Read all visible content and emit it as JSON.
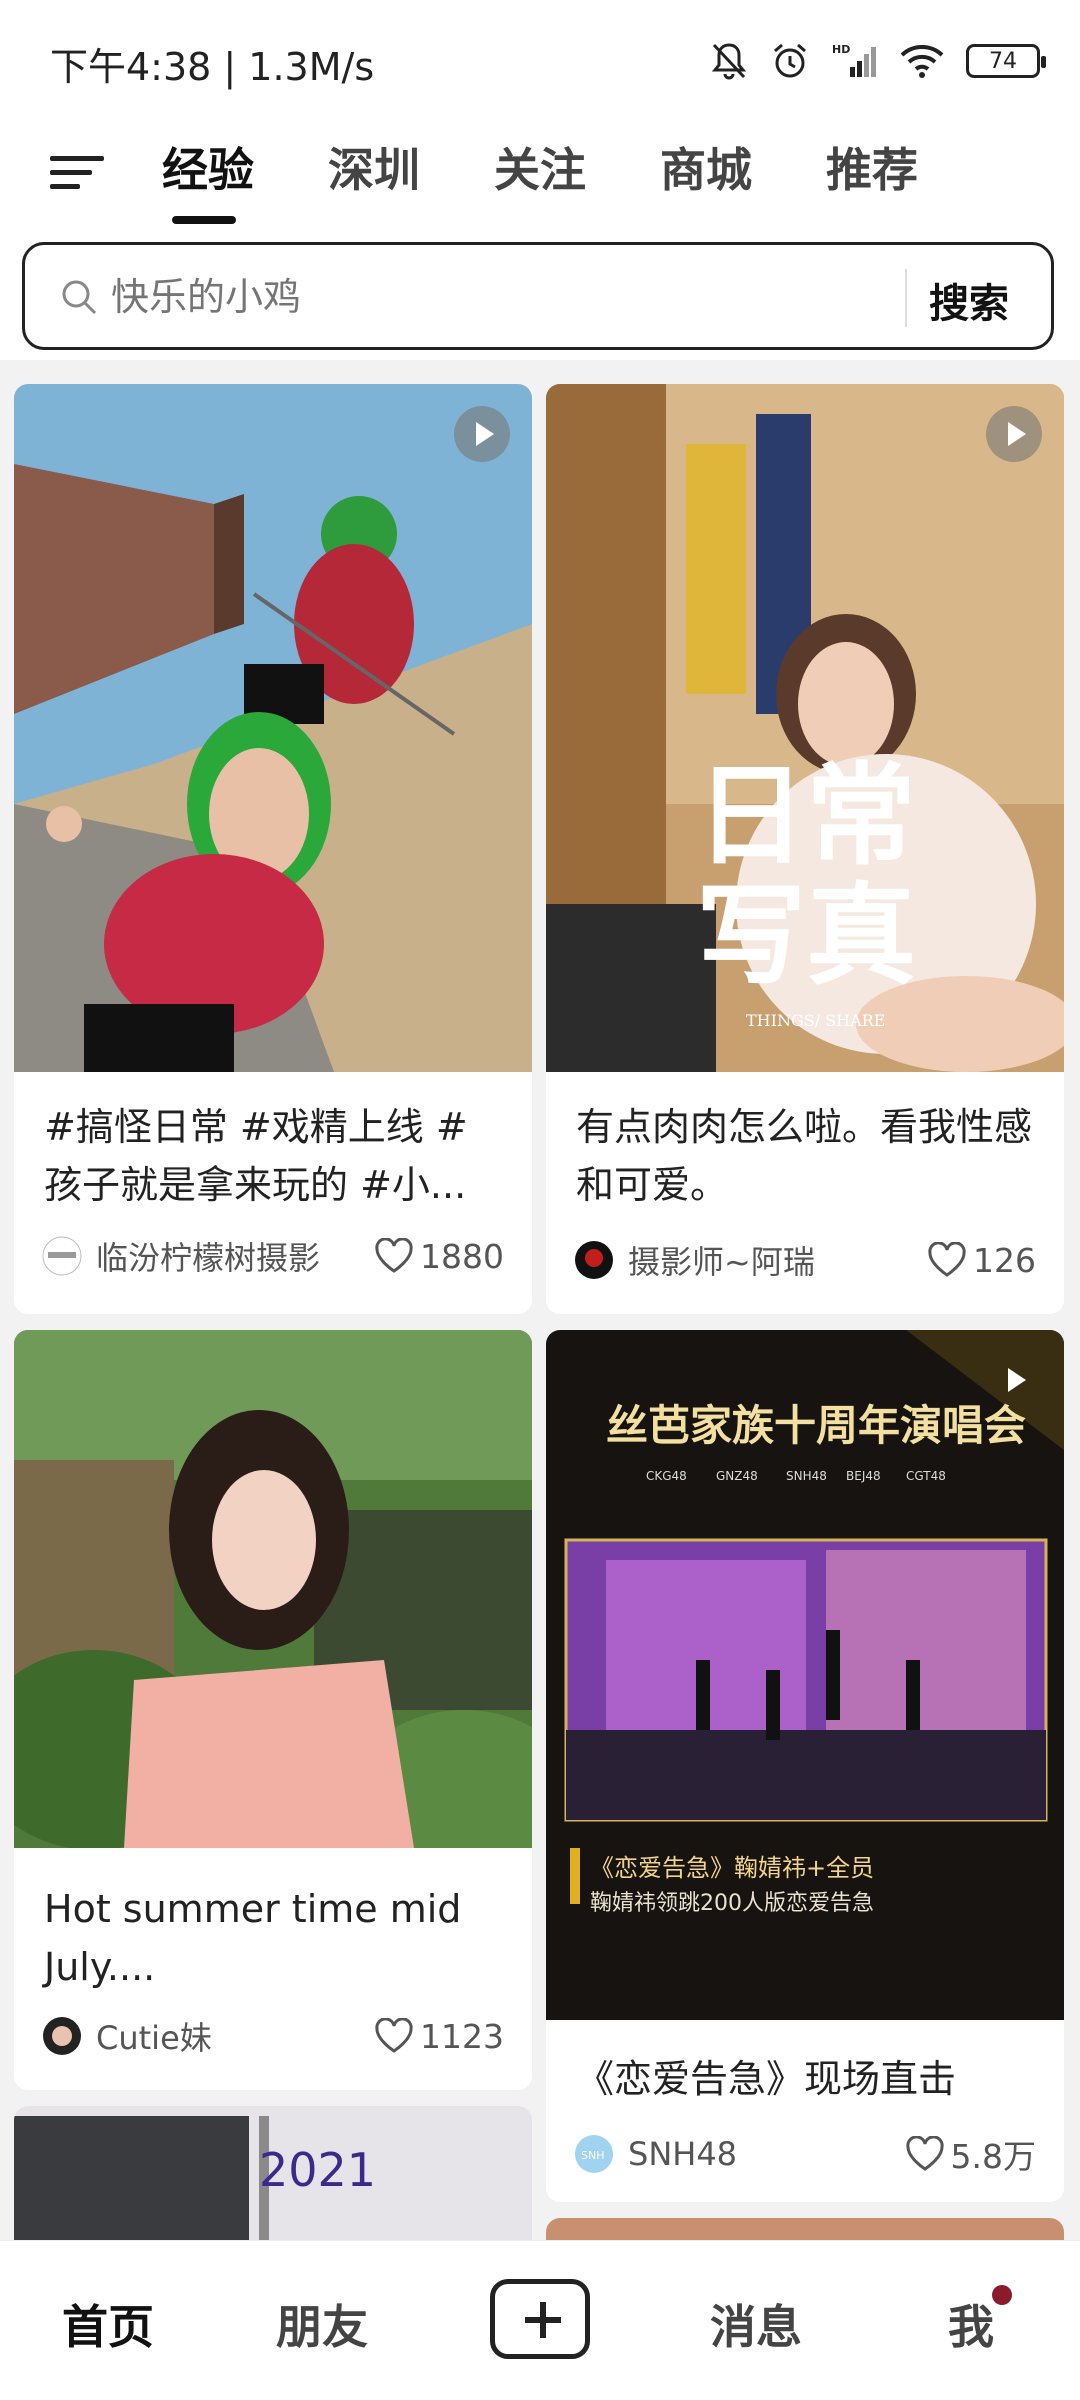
{
  "status_bar": {
    "time_speed": "下午4:38 | 1.3M/s",
    "battery": "74"
  },
  "tabs": [
    {
      "label": "经验",
      "active": true
    },
    {
      "label": "深圳"
    },
    {
      "label": "关注"
    },
    {
      "label": "商城"
    },
    {
      "label": "推荐"
    }
  ],
  "search": {
    "placeholder": "快乐的小鸡",
    "button": "搜索"
  },
  "feed": [
    {
      "title": "#搞怪日常 #戏精上线 #孩子就是拿来玩的 #小...",
      "author": "临汾柠檬树摄影",
      "likes": "1880",
      "is_video": true
    },
    {
      "title": "有点肉肉怎么啦。看我性感和可爱。",
      "author": "摄影师~阿瑞",
      "likes": "126",
      "is_video": true,
      "image_text": [
        "日常",
        "写真",
        "THINGS/ SHARE"
      ]
    },
    {
      "title": "Hot summer time mid July....",
      "author": "Cutie妹",
      "likes": "1123",
      "is_video": false
    },
    {
      "title": "《恋爱告急》现场直击",
      "author": "SNH48",
      "likes": "5.8万",
      "is_video": true,
      "image_text": [
        "丝芭家族十周年演唱会",
        "CKG48",
        "GNZ48",
        "SNH48",
        "BEJ48",
        "CGT48",
        "《恋爱告急》鞠婧祎+全员",
        "鞠婧祎领跳200人版恋爱告急"
      ]
    },
    {
      "title": "",
      "author": "",
      "likes": "",
      "image_text": [
        "2021"
      ]
    }
  ],
  "bottom_nav": [
    {
      "label": "首页",
      "active": true
    },
    {
      "label": "朋友"
    },
    {
      "label": "消息"
    },
    {
      "label": "我"
    }
  ],
  "colors": {
    "accent": "#111111",
    "badge": "#8b1a2b",
    "background": "#f2f2f2"
  }
}
